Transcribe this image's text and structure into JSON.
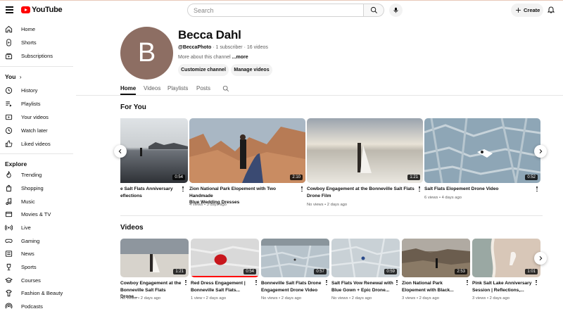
{
  "header": {
    "logo_text": "YouTube",
    "search_placeholder": "Search",
    "create_label": "Create"
  },
  "sidebar": {
    "primary": [
      {
        "label": "Home",
        "icon": "home-icon"
      },
      {
        "label": "Shorts",
        "icon": "shorts-icon"
      },
      {
        "label": "Subscriptions",
        "icon": "subscriptions-icon"
      }
    ],
    "you_heading": "You",
    "you_items": [
      {
        "label": "History",
        "icon": "history-icon"
      },
      {
        "label": "Playlists",
        "icon": "playlists-icon"
      },
      {
        "label": "Your videos",
        "icon": "your-videos-icon"
      },
      {
        "label": "Watch later",
        "icon": "watch-later-icon"
      },
      {
        "label": "Liked videos",
        "icon": "liked-videos-icon"
      }
    ],
    "explore_heading": "Explore",
    "explore_items": [
      {
        "label": "Trending",
        "icon": "trending-icon"
      },
      {
        "label": "Shopping",
        "icon": "shopping-icon"
      },
      {
        "label": "Music",
        "icon": "music-icon"
      },
      {
        "label": "Movies & TV",
        "icon": "movies-icon"
      },
      {
        "label": "Live",
        "icon": "live-icon"
      },
      {
        "label": "Gaming",
        "icon": "gaming-icon"
      },
      {
        "label": "News",
        "icon": "news-icon"
      },
      {
        "label": "Sports",
        "icon": "sports-icon"
      },
      {
        "label": "Courses",
        "icon": "courses-icon"
      },
      {
        "label": "Fashion & Beauty",
        "icon": "fashion-icon"
      },
      {
        "label": "Podcasts",
        "icon": "podcasts-icon"
      }
    ]
  },
  "channel": {
    "avatar_letter": "B",
    "name": "Becca Dahl",
    "handle": "@BeccaPhoto",
    "subscribers": "1 subscriber",
    "videos": "16 videos",
    "about": "More about this channel",
    "about_more": "...more",
    "customize_label": "Customize channel",
    "manage_label": "Manage videos",
    "avatar_color": "#8d6e63"
  },
  "tabs": [
    "Home",
    "Videos",
    "Playlists",
    "Posts"
  ],
  "for_you": {
    "title": "For You",
    "items": [
      {
        "title_l1": "e Salt Flats Anniversary",
        "title_l2": "eflections",
        "meta": "",
        "duration": "0:54"
      },
      {
        "title_l1": "Zion National Park Elopement with Two Handmade",
        "title_l2": "Blue Wedding Dresses",
        "meta": "4 views • 3 days ago",
        "duration": "2:10"
      },
      {
        "title_l1": "Cowboy Engagement at the Bonneville Salt Flats",
        "title_l2": "Drone Film",
        "meta": "No views • 2 days ago",
        "duration": "1:21"
      },
      {
        "title_l1": "Salt Flats Elopement Drone Video",
        "title_l2": "",
        "meta": "6 views • 4 days ago",
        "duration": "0:52"
      }
    ]
  },
  "videos": {
    "title": "Videos",
    "items": [
      {
        "title_l1": "Cowboy Engagement at the",
        "title_l2": "Bonneville Salt Flats Drone...",
        "meta": "No views • 2 days ago",
        "duration": "1:21",
        "progress": 0
      },
      {
        "title_l1": "Red Dress Engagement |",
        "title_l2": "Bonneville Salt Flats...",
        "meta": "1 view • 2 days ago",
        "duration": "0:54",
        "progress": 1
      },
      {
        "title_l1": "Bonneville Salt Flats Drone",
        "title_l2": "Engagement Drone Video",
        "meta": "No views • 2 days ago",
        "duration": "0:57",
        "progress": 0
      },
      {
        "title_l1": "Salt Flats Vow Renewal with",
        "title_l2": "Blue Gown + Epic Drone...",
        "meta": "No views • 2 days ago",
        "duration": "0:59",
        "progress": 0
      },
      {
        "title_l1": "Zion National Park",
        "title_l2": "Elopement with Black...",
        "meta": "3 views • 2 days ago",
        "duration": "2:53",
        "progress": 0
      },
      {
        "title_l1": "Pink Salt Lake Anniversary",
        "title_l2": "Session | Reflections,...",
        "meta": "3 views • 2 days ago",
        "duration": "1:01",
        "progress": 0
      }
    ]
  }
}
